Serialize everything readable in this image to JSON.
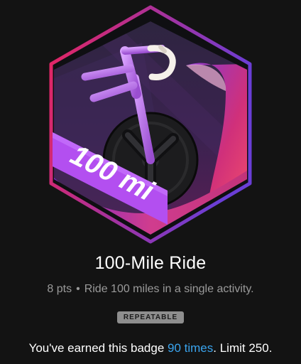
{
  "badge": {
    "banner_text": "100 mi",
    "icon": "bicycle-icon",
    "colors": {
      "hex_border_start": "#e8245e",
      "hex_border_end": "#6a3ed6",
      "inner_bg": "#3a2455",
      "banner": "#b34ff0",
      "frame": "#c98bf0"
    }
  },
  "title": "100-Mile Ride",
  "points": "8 pts",
  "separator": "•",
  "description": "Ride 100 miles in a single activity.",
  "tag": "REPEATABLE",
  "earned": {
    "prefix": "You've earned this badge ",
    "count_text": "90 times",
    "suffix": ". Limit 250."
  },
  "theme": {
    "background": "#131313",
    "link": "#3aa4ee"
  }
}
